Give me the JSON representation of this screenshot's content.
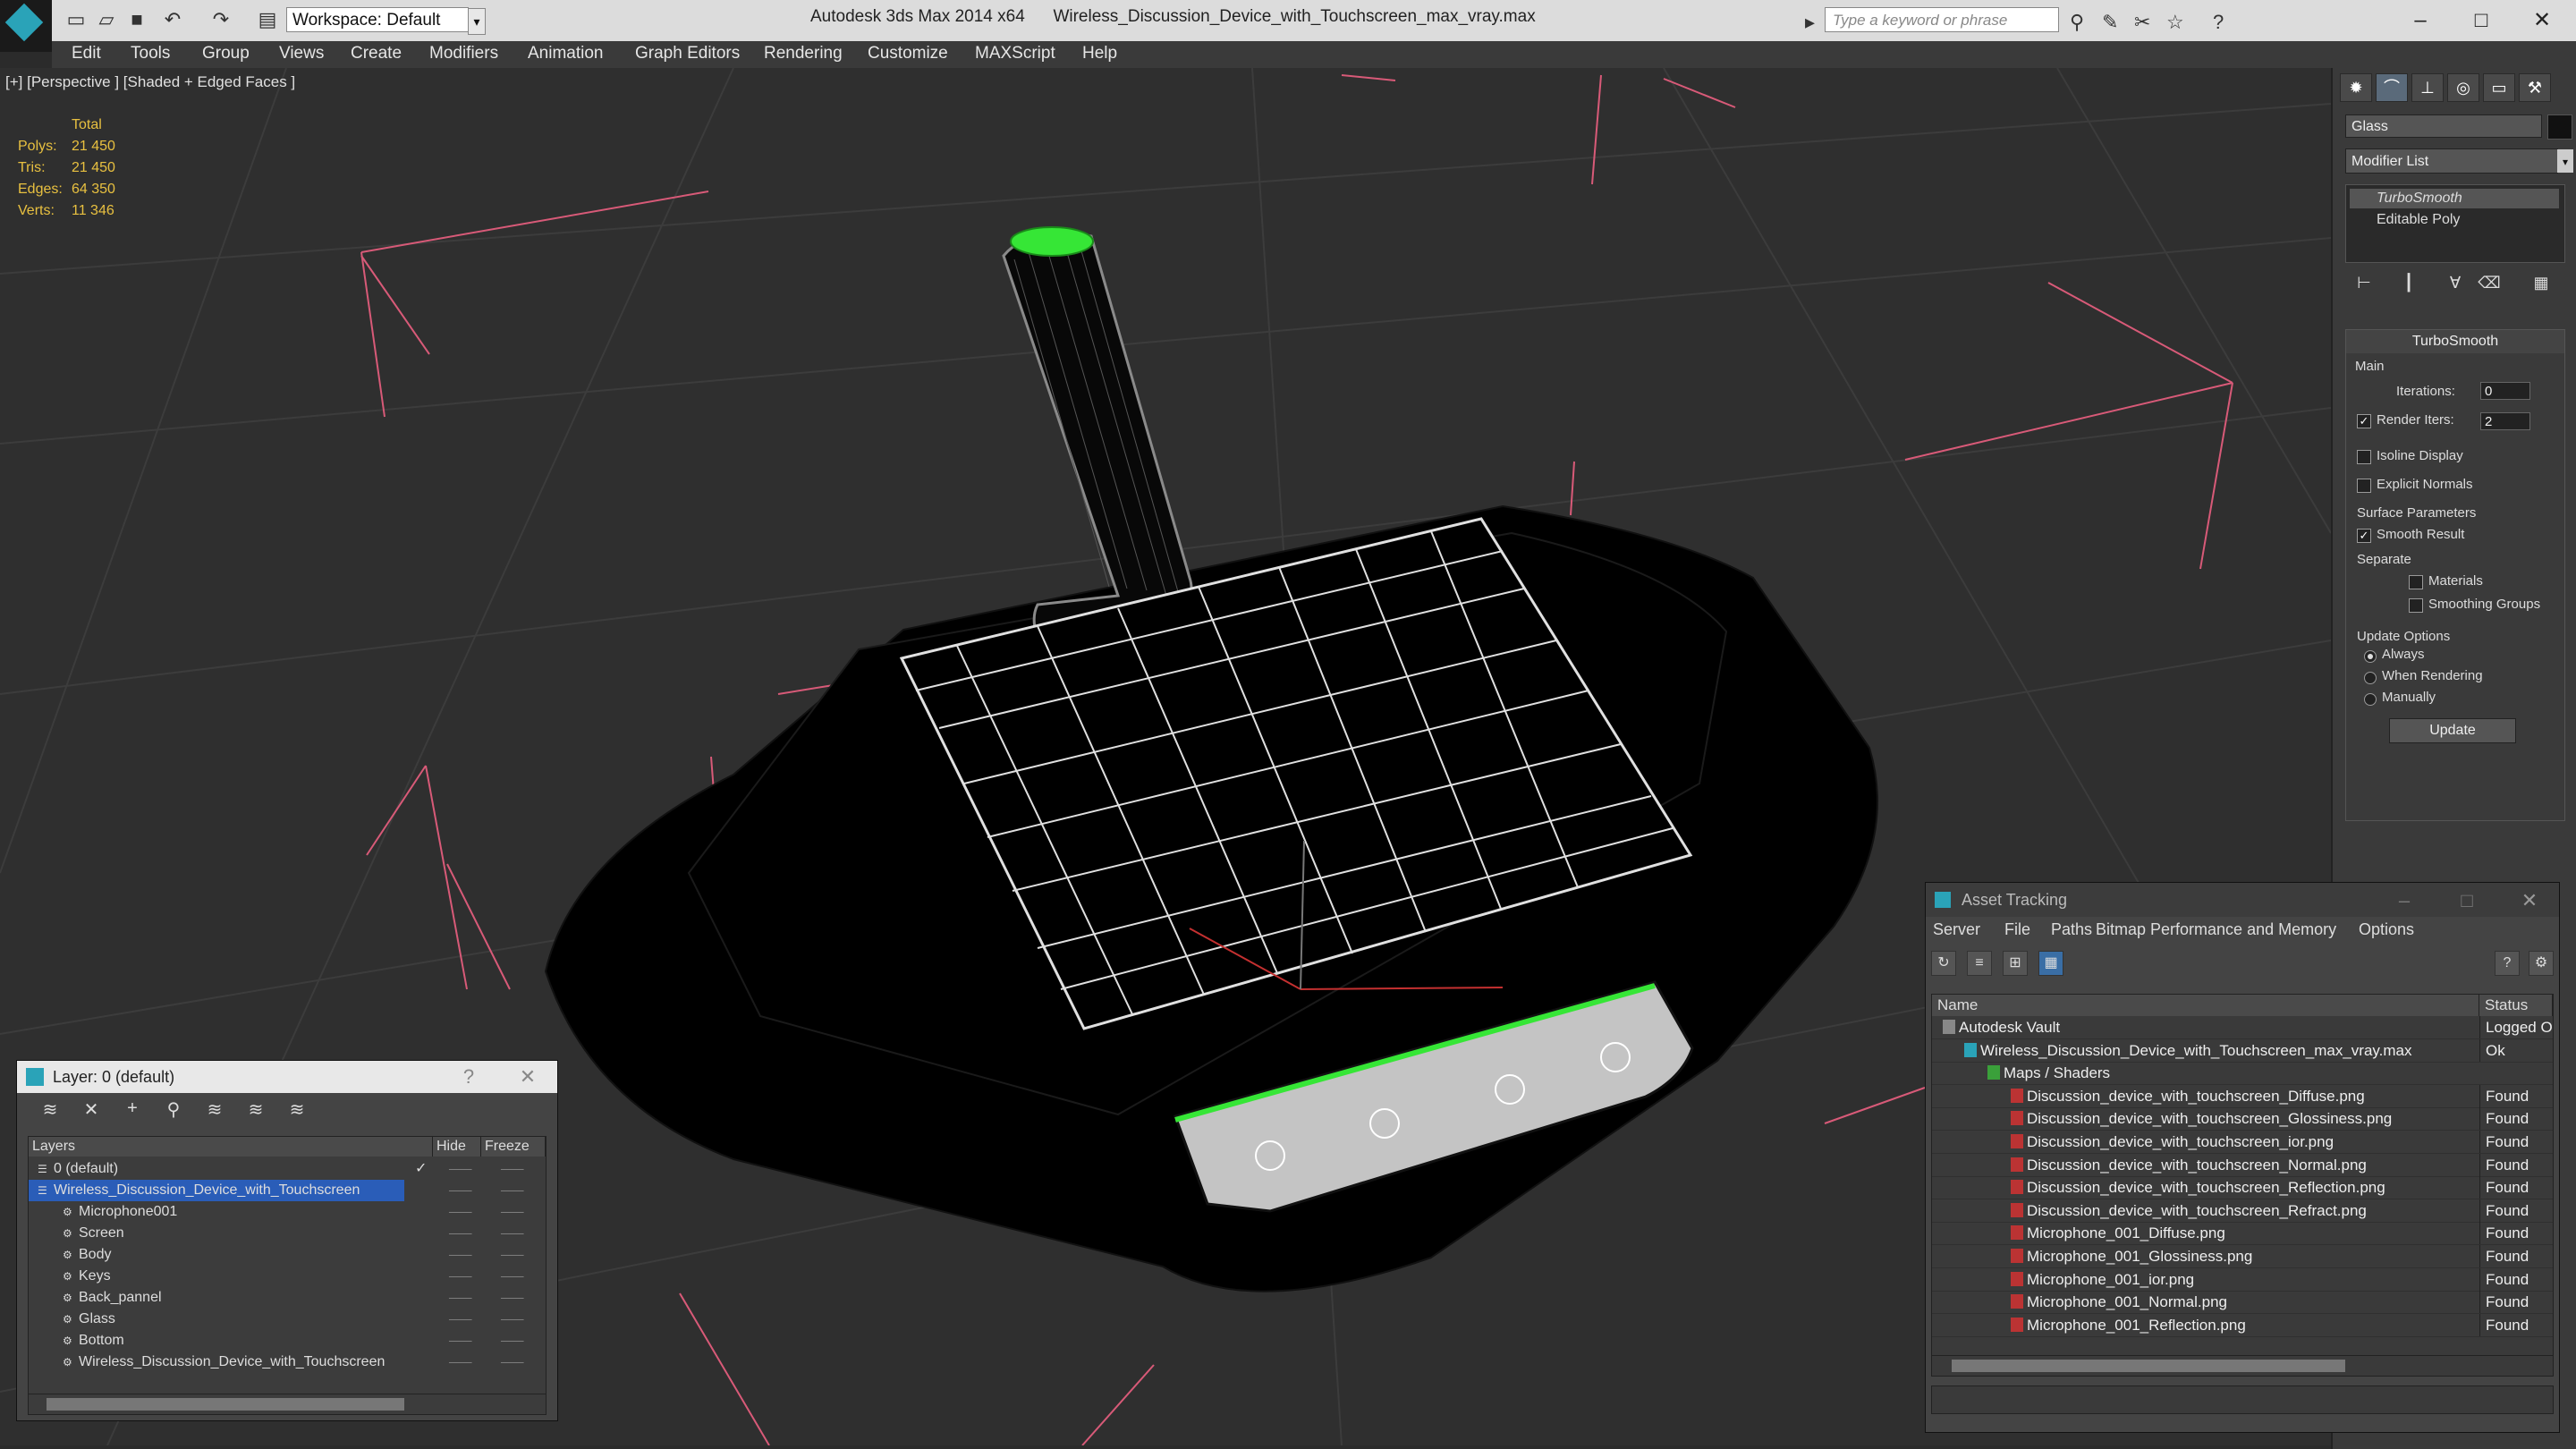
{
  "titlebar": {
    "workspace": "Workspace: Default",
    "app": "Autodesk 3ds Max 2014 x64",
    "file": "Wireless_Discussion_Device_with_Touchscreen_max_vray.max",
    "search_placeholder": "Type a keyword or phrase"
  },
  "menu": [
    "Edit",
    "Tools",
    "Group",
    "Views",
    "Create",
    "Modifiers",
    "Animation",
    "Graph Editors",
    "Rendering",
    "Customize",
    "MAXScript",
    "Help"
  ],
  "viewport": {
    "label": "[+] [Perspective ] [Shaded + Edged Faces ]",
    "stats_header": "Total",
    "stats": [
      {
        "k": "Polys:",
        "v": "21 450"
      },
      {
        "k": "Tris:",
        "v": "21 450"
      },
      {
        "k": "Edges:",
        "v": "64 350"
      },
      {
        "k": "Verts:",
        "v": "11 346"
      }
    ]
  },
  "command_panel": {
    "object_name": "Glass",
    "modifier_list": "Modifier List",
    "stack": [
      "TurboSmooth",
      "Editable Poly"
    ],
    "turbosmooth": {
      "title": "TurboSmooth",
      "main": "Main",
      "iterations_label": "Iterations:",
      "iterations": "0",
      "render_iters_label": "Render Iters:",
      "render_iters": "2",
      "isoline": "Isoline Display",
      "explicit": "Explicit Normals",
      "surface": "Surface Parameters",
      "smooth_result": "Smooth Result",
      "separate": "Separate",
      "materials": "Materials",
      "smoothing_groups": "Smoothing Groups",
      "update_options": "Update Options",
      "always": "Always",
      "when_rendering": "When Rendering",
      "manually": "Manually",
      "update": "Update"
    }
  },
  "layer_dialog": {
    "title": "Layer: 0 (default)",
    "col_layers": "Layers",
    "col_hide": "Hide",
    "col_freeze": "Freeze",
    "rows": [
      "0 (default)",
      "Wireless_Discussion_Device_with_Touchscreen",
      "Microphone001",
      "Screen",
      "Body",
      "Keys",
      "Back_pannel",
      "Glass",
      "Bottom",
      "Wireless_Discussion_Device_with_Touchscreen"
    ]
  },
  "asset_tracking": {
    "title": "Asset Tracking",
    "menu": [
      "Server",
      "File",
      "Paths",
      "Bitmap Performance and Memory",
      "Options"
    ],
    "col_name": "Name",
    "col_status": "Status",
    "rows": [
      {
        "name": "Autodesk Vault",
        "status": "Logged O"
      },
      {
        "name": "Wireless_Discussion_Device_with_Touchscreen_max_vray.max",
        "status": "Ok"
      },
      {
        "name": "Maps / Shaders",
        "status": ""
      },
      {
        "name": "Discussion_device_with_touchscreen_Diffuse.png",
        "status": "Found"
      },
      {
        "name": "Discussion_device_with_touchscreen_Glossiness.png",
        "status": "Found"
      },
      {
        "name": "Discussion_device_with_touchscreen_ior.png",
        "status": "Found"
      },
      {
        "name": "Discussion_device_with_touchscreen_Normal.png",
        "status": "Found"
      },
      {
        "name": "Discussion_device_with_touchscreen_Reflection.png",
        "status": "Found"
      },
      {
        "name": "Discussion_device_with_touchscreen_Refract.png",
        "status": "Found"
      },
      {
        "name": "Microphone_001_Diffuse.png",
        "status": "Found"
      },
      {
        "name": "Microphone_001_Glossiness.png",
        "status": "Found"
      },
      {
        "name": "Microphone_001_ior.png",
        "status": "Found"
      },
      {
        "name": "Microphone_001_Normal.png",
        "status": "Found"
      },
      {
        "name": "Microphone_001_Reflection.png",
        "status": "Found"
      }
    ]
  }
}
